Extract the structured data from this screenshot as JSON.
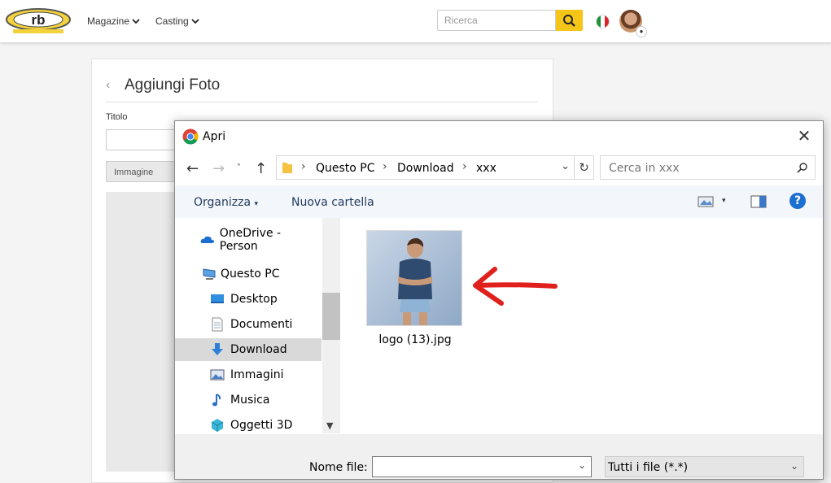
{
  "nav": {
    "brand": "rb",
    "menu_magazine": "Magazine",
    "menu_casting": "Casting",
    "search_placeholder": "Ricerca"
  },
  "card": {
    "title": "Aggiungi Foto",
    "field_label": "Titolo",
    "tab_label": "Immagine"
  },
  "dialog": {
    "title": "Apri",
    "breadcrumb": [
      "Questo PC",
      "Download",
      "xxx"
    ],
    "search_placeholder": "Cerca in xxx",
    "organizza": "Organizza",
    "nuova_cartella": "Nuova cartella",
    "sidebar": [
      {
        "label": "OneDrive - Person",
        "icon": "cloud-icon"
      },
      {
        "label": "Questo PC",
        "icon": "computer-icon"
      },
      {
        "label": "Desktop",
        "icon": "desktop-icon"
      },
      {
        "label": "Documenti",
        "icon": "document-icon"
      },
      {
        "label": "Download",
        "icon": "download-icon",
        "selected": true
      },
      {
        "label": "Immagini",
        "icon": "pictures-icon"
      },
      {
        "label": "Musica",
        "icon": "music-icon"
      },
      {
        "label": "Oggetti 3D",
        "icon": "cube-icon"
      }
    ],
    "file_name": "logo (13).jpg",
    "filename_label": "Nome file:",
    "filename_value": "",
    "filter": "Tutti i file (*.*)"
  },
  "colors": {
    "accent_yellow": "#f5c518",
    "windows_blue": "#1a6fd1",
    "arrow_red": "#e0201c"
  }
}
